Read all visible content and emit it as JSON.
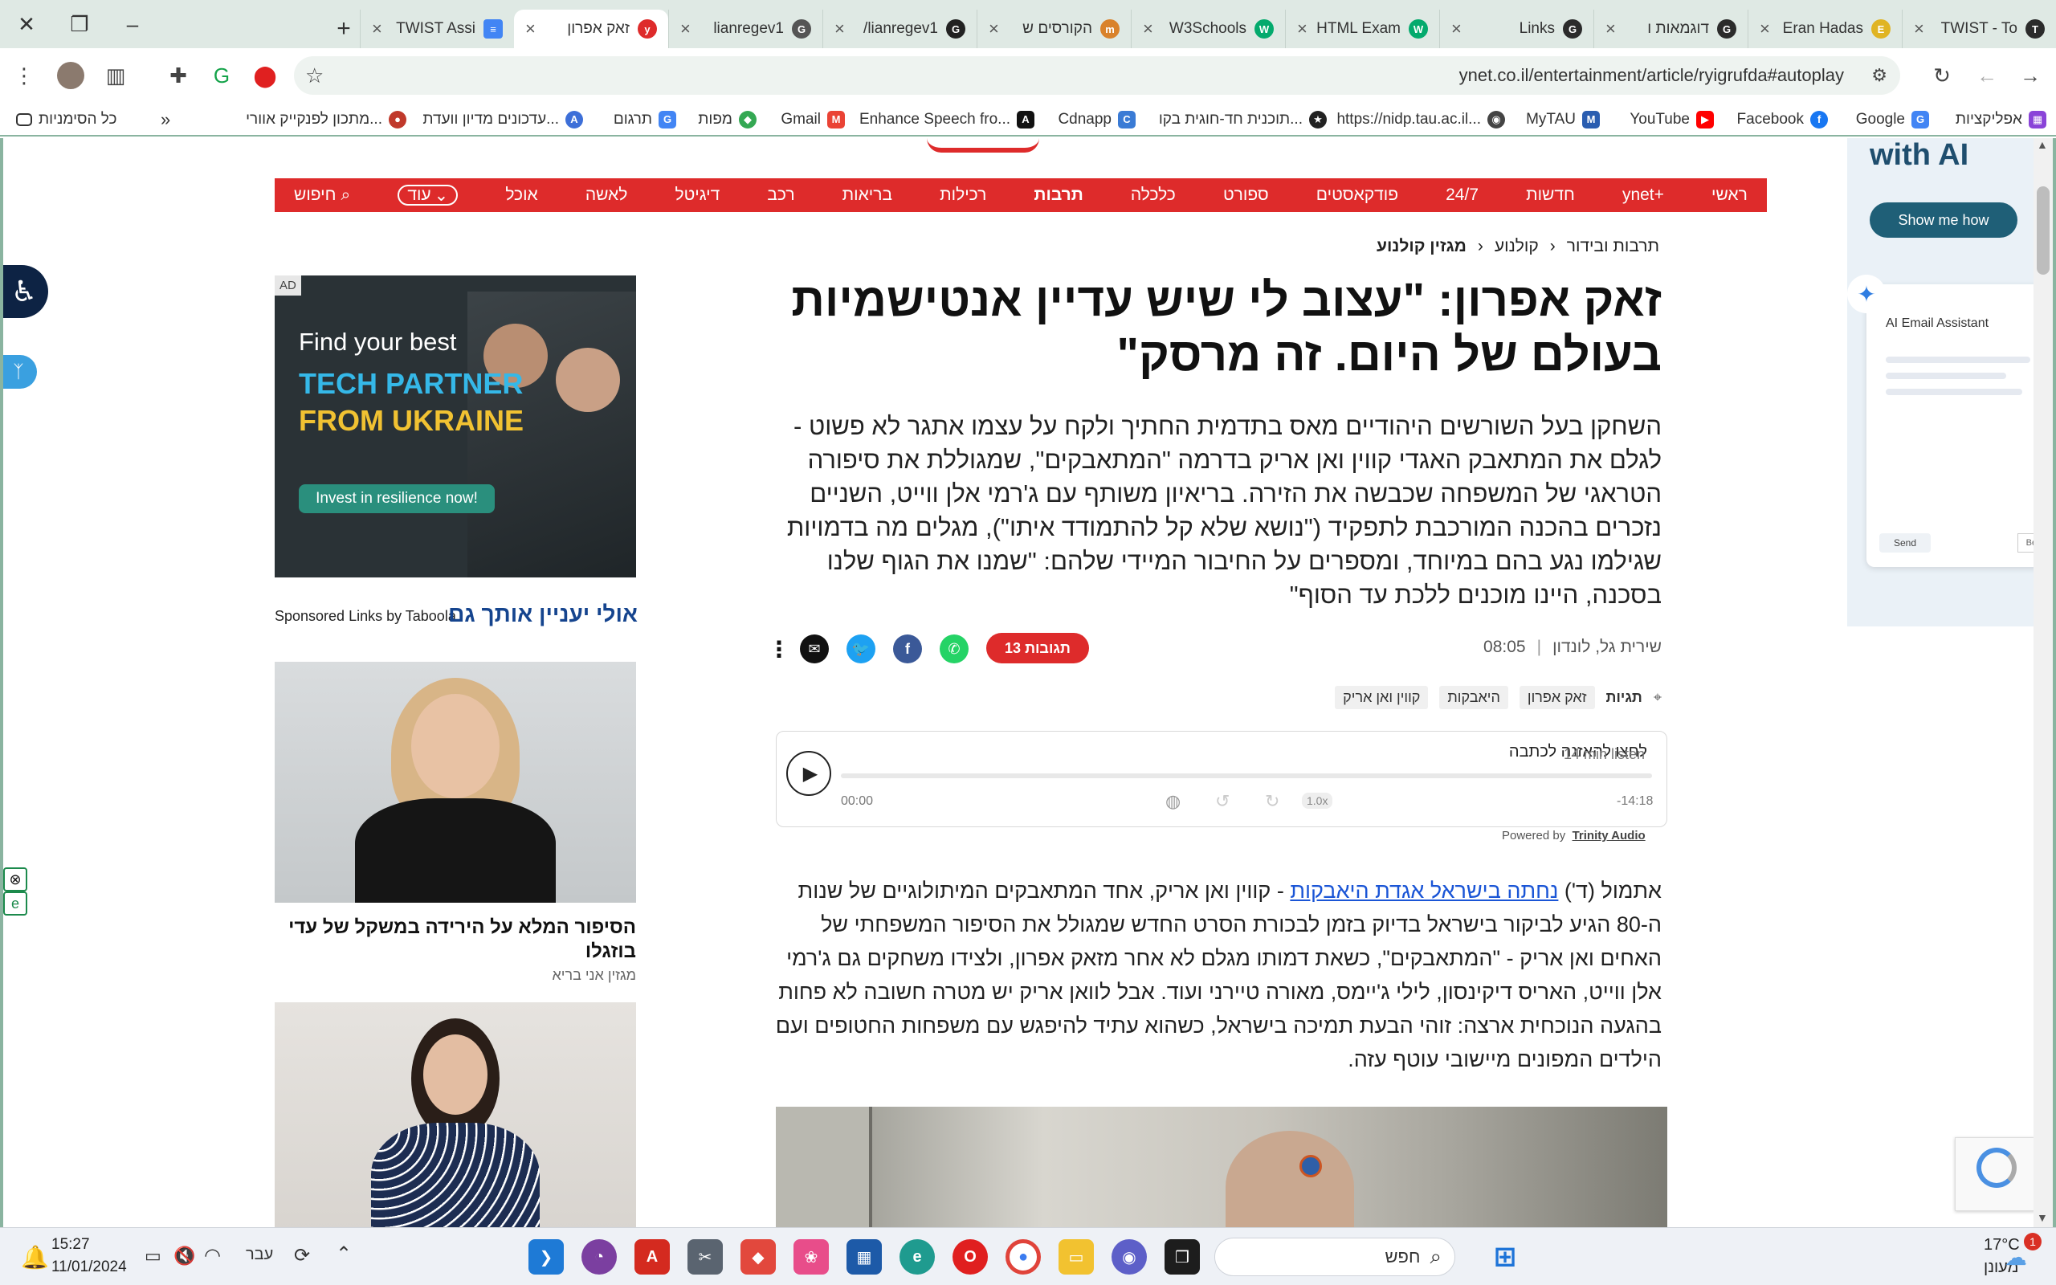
{
  "browser": {
    "tabs": [
      {
        "title": "TWIST - To",
        "icon": "T",
        "color": "#2b2b2b"
      },
      {
        "title": "Eran Hadas",
        "icon": "E",
        "color": "#e0b423"
      },
      {
        "title": "דוגמאות ו",
        "icon": "G",
        "color": "#2b2b2b"
      },
      {
        "title": "Links",
        "icon": "G",
        "color": "#2b2b2b"
      },
      {
        "title": "HTML Exam",
        "icon": "W",
        "color": "#04aa6d"
      },
      {
        "title": "W3Schools",
        "icon": "W",
        "color": "#04aa6d"
      },
      {
        "title": "הקורסים ש",
        "icon": "m",
        "color": "#d9822b"
      },
      {
        "title": "lianregev1/",
        "icon": "G",
        "color": "#222222"
      },
      {
        "title": "lianregev1",
        "icon": "G",
        "color": "#555555"
      },
      {
        "title": "זאק אפרון",
        "icon": "y",
        "color": "#de2b2b"
      },
      {
        "title": "TWIST Assi",
        "icon": "D",
        "color": "#4285f4"
      }
    ],
    "url": "ynet.co.il/entertainment/article/ryigrufda#autoplay",
    "bookmarks": [
      {
        "label": "אפליקציות",
        "icon": "A",
        "color": "#8a44d8"
      },
      {
        "label": "Google",
        "icon": "G",
        "color": "#4285f4"
      },
      {
        "label": "Facebook",
        "icon": "f",
        "color": "#1877f2"
      },
      {
        "label": "YouTube",
        "icon": "▶",
        "color": "#ff0000"
      },
      {
        "label": "MyTAU",
        "icon": "M",
        "color": "#2a5db0"
      },
      {
        "label": "https://nidp.tau.ac.il...",
        "icon": "◉",
        "color": "#444444"
      },
      {
        "label": "תוכנית חד-חוגית בקו...",
        "icon": "★",
        "color": "#222222"
      },
      {
        "label": "Cdnapp",
        "icon": "C",
        "color": "#3a7bd5"
      },
      {
        "label": "Enhance Speech fro...",
        "icon": "A",
        "color": "#111111"
      },
      {
        "label": "Gmail",
        "icon": "M",
        "color": "#ea4335"
      },
      {
        "label": "מפות",
        "icon": "◆",
        "color": "#34a853"
      },
      {
        "label": "תרגום",
        "icon": "G",
        "color": "#4285f4"
      },
      {
        "label": "עדכונים מדיון וועדת...",
        "icon": "A",
        "color": "#3d6fd8"
      },
      {
        "label": "מתכון לפנקייק אוורי...",
        "icon": "●",
        "color": "#c0392b"
      }
    ],
    "all_bookmarks": "כל הסימניות",
    "more_bookmarks": "»"
  },
  "site": {
    "nav": [
      "ראשי",
      "ynet+",
      "חדשות",
      "24/7",
      "פודקאסטים",
      "ספורט",
      "כלכלה",
      "תרבות",
      "רכילות",
      "בריאות",
      "רכב",
      "דיגיטל",
      "לאשה",
      "אוכל"
    ],
    "nav_current": "תרבות",
    "nav_more": "עוד",
    "nav_search": "חיפוש",
    "breadcrumbs": [
      "תרבות ובידור",
      "קולנוע",
      "מגזין קולנוע"
    ],
    "headline": "זאק אפרון: \"עצוב לי שיש עדיין אנטישמיות בעולם של היום. זה מרסק\"",
    "lead": "השחקן בעל השורשים היהודיים מאס בתדמית החתיך ולקח על עצמו אתגר לא פשוט - לגלם את המתאבק האגדי קווין ואן אריק בדרמה \"המתאבקים\", שמגוללת את סיפורה הטראגי של המשפחה שכבשה את הזירה. בריאיון משותף עם ג'רמי אלן ווייט, השניים נזכרים בהכנה המורכבת לתפקיד (\"נושא שלא קל להתמודד איתו\"), מגלים מה בדמויות שגילמו נגע בהם במיוחד, ומספרים על החיבור המיידי שלהם: \"שמנו את הגוף שלנו בסכנה, היינו מוכנים ללכת עד הסוף\"",
    "author": "שירית גל, לונדון",
    "time": "08:05",
    "comments": "13 תגובות",
    "tags_label": "תגיות",
    "tags": [
      "זאק אפרון",
      "היאבקות",
      "קווין ואן אריק"
    ],
    "player": {
      "prompt": "לחצו להאזנה לכתבה",
      "listen": "14 min listen",
      "current": "00:00",
      "remaining": "-14:18",
      "speed": "1.0x",
      "powered": "Powered by",
      "brand": "Trinity Audio"
    },
    "body_link": "נחתה בישראל אגדת היאבקות",
    "body_prefix": "אתמול (ד') ",
    "body_rest": " - קווין ואן אריק, אחד המתאבקים המיתולוגיים של שנות ה-80 הגיע לביקור בישראל בדיוק בזמן לבכורת הסרט החדש שמגולל את הסיפור המשפחתי של האחים ואן אריק - \"המתאבקים\", כשאת דמותו מגלם לא אחר מזאק אפרון, ולצידו משחקים גם ג'רמי אלן ווייט, האריס דיקינסון, לילי ג'יימס, מאורה טיירני ועוד. אבל לוואן אריק יש מטרה חשובה לא פחות בהגעה הנוכחית ארצה: זוהי הבעת תמיכה בישראל, כשהוא עתיד להיפגש עם משפחות החטופים ועם הילדים המפונים מיישובי עוטף עזה.",
    "ad": {
      "label": "AD",
      "line1": "Find your best",
      "line2": "TECH PARTNER",
      "line3": "FROM UKRAINE",
      "cta": "Invest in resilience now!"
    },
    "sponsored": "Sponsored Links by Taboola",
    "maybe": "אולי יעניין אותך גם",
    "card1_title": "הסיפור המלא על הירידה במשקל של עדי בוזגלו",
    "card1_source": "מגזין אני בריא",
    "right_ad": {
      "headline": "with AI",
      "cta": "Show me how",
      "widget": "AI Email Assistant",
      "send": "Send",
      "beta": "Beta"
    }
  },
  "taskbar": {
    "time": "15:27",
    "date": "11/01/2024",
    "lang": "עבר",
    "search_placeholder": "חפש",
    "weather_temp": "17°C",
    "weather_text": "מעונן",
    "notif_count": "1"
  }
}
